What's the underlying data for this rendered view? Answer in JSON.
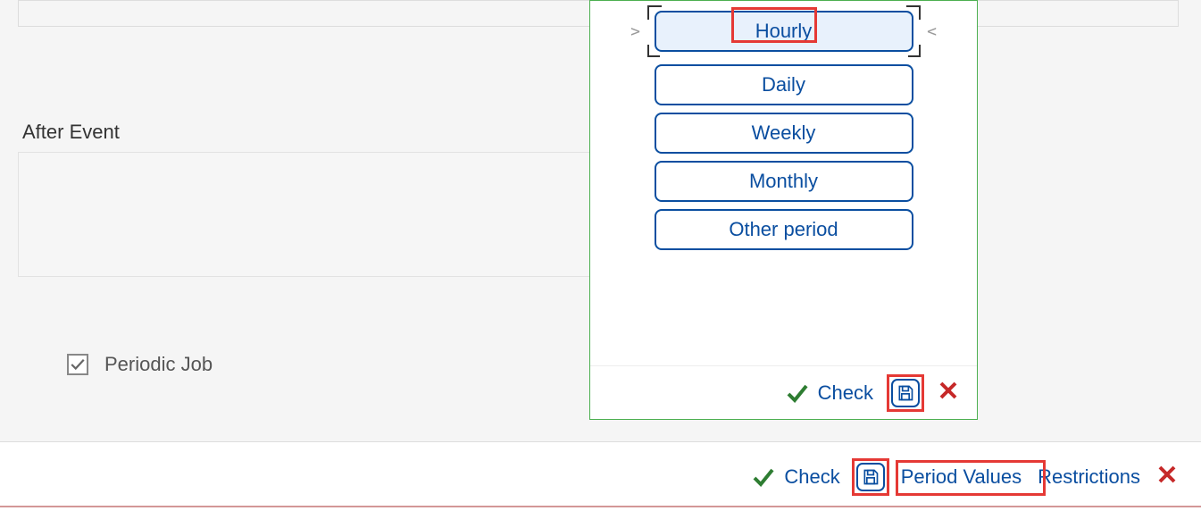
{
  "main": {
    "after_event_label": "After Event",
    "periodic_job_label": "Periodic Job",
    "periodic_job_checked": true
  },
  "popup": {
    "options": [
      "Hourly",
      "Daily",
      "Weekly",
      "Monthly",
      "Other period"
    ],
    "selected_index": 0,
    "footer": {
      "check_label": "Check"
    }
  },
  "footer": {
    "check_label": "Check",
    "period_values_label": "Period Values",
    "restrictions_label": "Restrictions"
  }
}
